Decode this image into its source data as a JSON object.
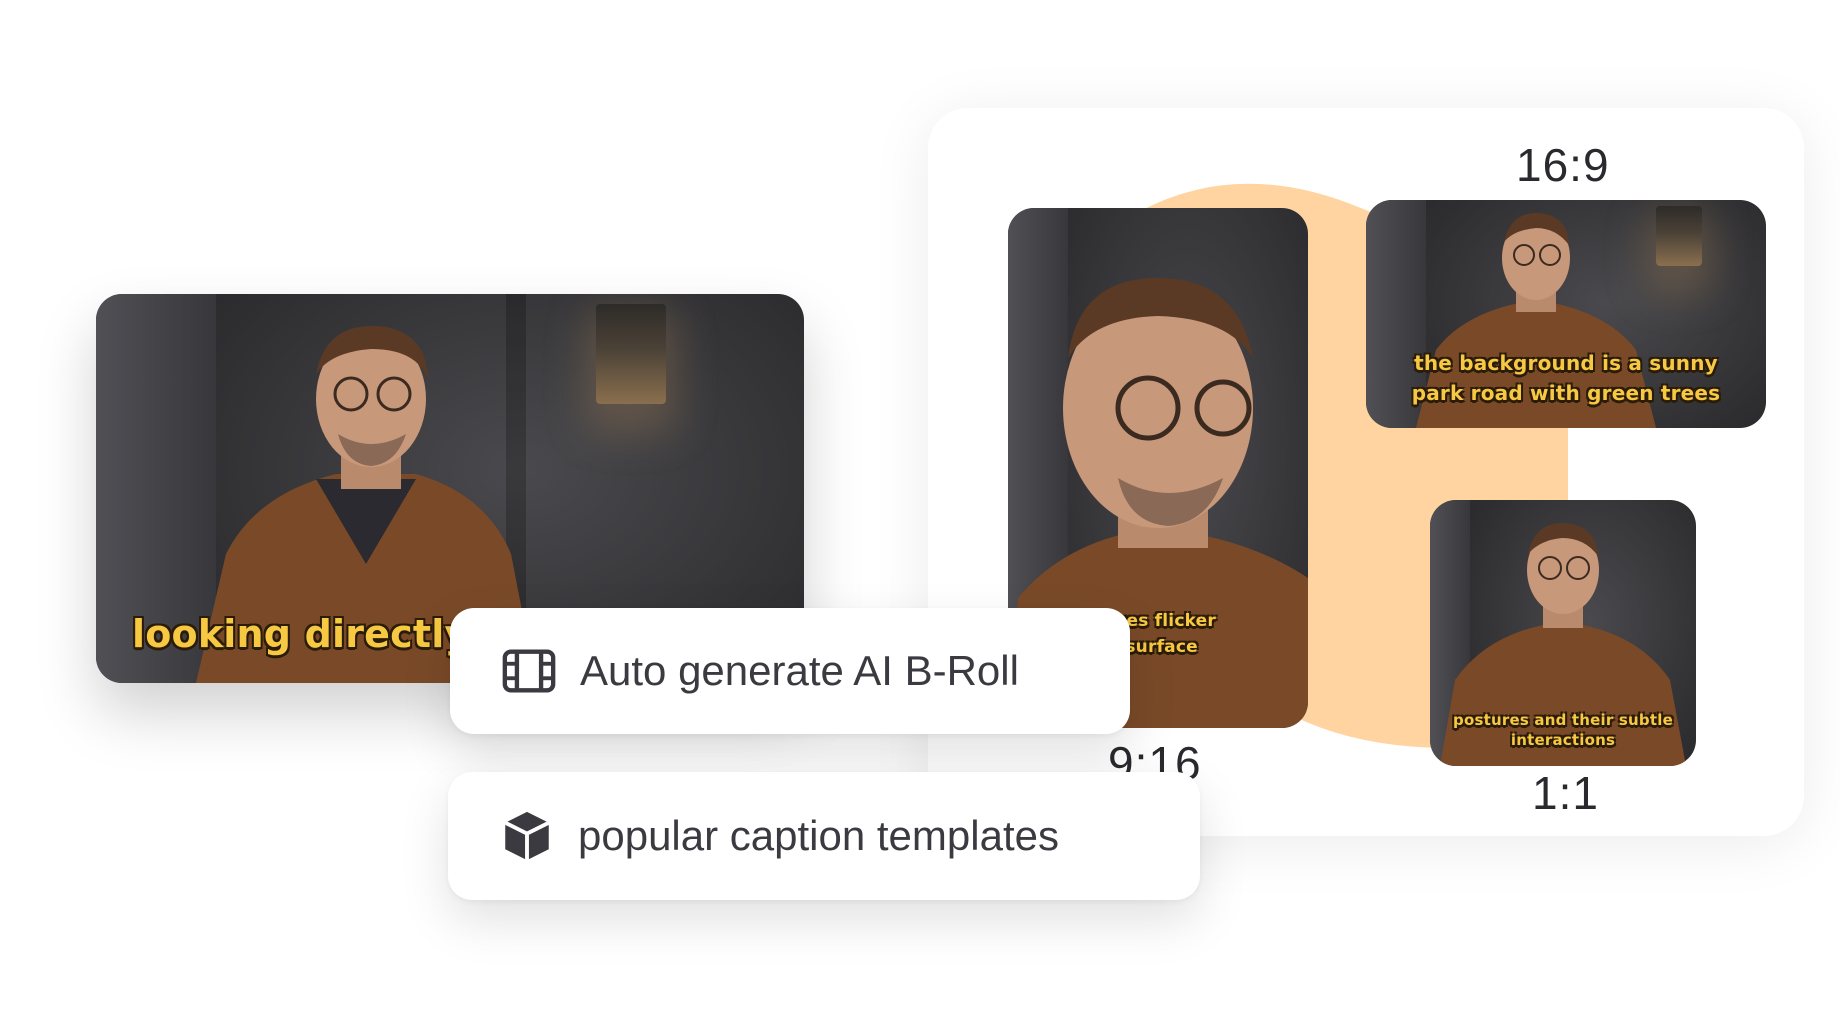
{
  "main_video": {
    "caption": "looking directly"
  },
  "ratio_card": {
    "labels": {
      "r169": "16:9",
      "r916": "9:16",
      "r11": "1:1"
    },
    "captions": {
      "v916": "d images flicker\ns its surface",
      "v169": "the background is a sunny\npark road with green trees",
      "v11": "postures and their subtle\ninteractions"
    },
    "accent_color": "#ffd4a1"
  },
  "features": {
    "broll_label": "Auto generate AI B-Roll",
    "broll_icon": "film-strip-icon",
    "templates_label": "popular caption templates",
    "templates_icon": "cube-icon"
  },
  "colors": {
    "caption": "#f7c842",
    "text": "#3a3a40"
  }
}
